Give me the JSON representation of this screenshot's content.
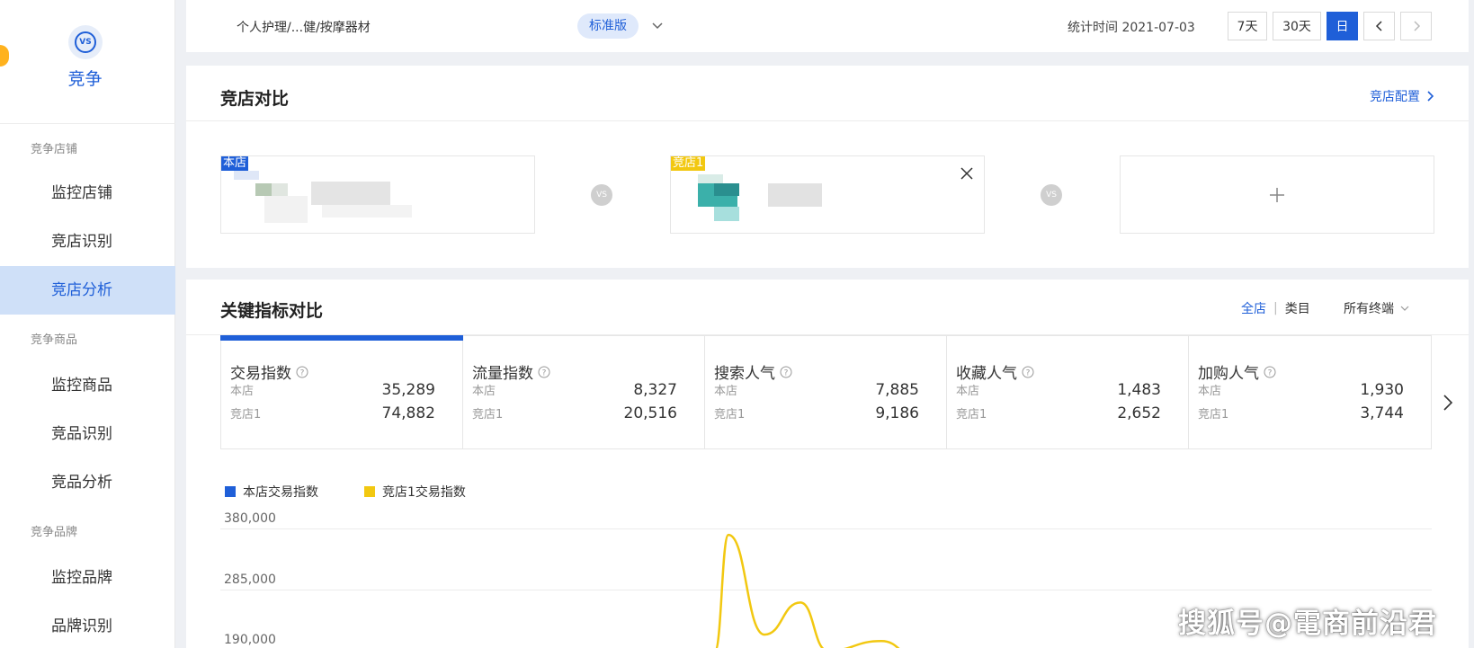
{
  "sidebar": {
    "title": "竞争",
    "logo_text": "VS",
    "groups": [
      {
        "label": "竞争店铺",
        "items": [
          "监控店铺",
          "竞店识别",
          "竞店分析"
        ]
      },
      {
        "label": "竞争商品",
        "items": [
          "监控商品",
          "竞品识别",
          "竞品分析"
        ]
      },
      {
        "label": "竞争品牌",
        "items": [
          "监控品牌",
          "品牌识别"
        ]
      }
    ],
    "active_item": "竞店分析"
  },
  "topbar": {
    "breadcrumb": "个人护理/...健/按摩器材",
    "badge": "标准版",
    "stat_time": "统计时间 2021-07-03",
    "ranges": [
      "7天",
      "30天",
      "日"
    ],
    "active_range": "日"
  },
  "compare": {
    "title": "竞店对比",
    "config_link": "竞店配置",
    "vs_text": "VS",
    "stores": [
      {
        "tag": "本店",
        "tag_color": "#1f5fd8"
      },
      {
        "tag": "竞店1",
        "tag_color": "#f2c811"
      }
    ]
  },
  "metrics": {
    "title": "关键指标对比",
    "scope_options": [
      "全店",
      "类目"
    ],
    "active_scope": "全店",
    "terminal": "所有终端",
    "own_label": "本店",
    "rival_label": "竞店1",
    "items": [
      {
        "name": "交易指数",
        "own": "35,289",
        "rival": "74,882",
        "active": true
      },
      {
        "name": "流量指数",
        "own": "8,327",
        "rival": "20,516",
        "active": false
      },
      {
        "name": "搜索人气",
        "own": "7,885",
        "rival": "9,186",
        "active": false
      },
      {
        "name": "收藏人气",
        "own": "1,483",
        "rival": "2,652",
        "active": false
      },
      {
        "name": "加购人气",
        "own": "1,930",
        "rival": "3,744",
        "active": false
      }
    ]
  },
  "chart_data": {
    "type": "line",
    "series": [
      {
        "name": "本店交易指数",
        "color": "#1f5fd8",
        "values": []
      },
      {
        "name": "竞店1交易指数",
        "color": "#f2c811",
        "values": [
          190000,
          370000,
          215000,
          265000,
          190000,
          205000,
          180000
        ]
      }
    ],
    "y_ticks": [
      "380,000",
      "285,000",
      "190,000"
    ],
    "ylim": [
      190000,
      380000
    ]
  },
  "watermark": "搜狐号@電商前沿君",
  "colors": {
    "accent": "#1f5fd8",
    "rival": "#f2c811",
    "active_side": "#cfe0f8"
  }
}
